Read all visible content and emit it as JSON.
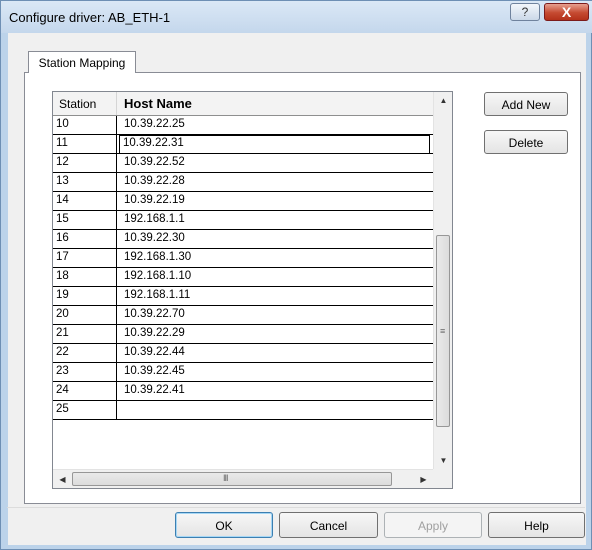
{
  "window": {
    "title": "Configure driver: AB_ETH-1",
    "help_glyph": "?",
    "close_glyph": "X"
  },
  "tab": {
    "label": "Station Mapping"
  },
  "grid": {
    "col_station": "Station",
    "col_host": "Host Name",
    "rows": [
      {
        "station": "10",
        "host": "10.39.22.25"
      },
      {
        "station": "11",
        "host": "10.39.22.31"
      },
      {
        "station": "12",
        "host": "10.39.22.52"
      },
      {
        "station": "13",
        "host": "10.39.22.28"
      },
      {
        "station": "14",
        "host": "10.39.22.19"
      },
      {
        "station": "15",
        "host": "192.168.1.1"
      },
      {
        "station": "16",
        "host": "10.39.22.30"
      },
      {
        "station": "17",
        "host": "192.168.1.30"
      },
      {
        "station": "18",
        "host": "192.168.1.10"
      },
      {
        "station": "19",
        "host": "192.168.1.11"
      },
      {
        "station": "20",
        "host": "10.39.22.70"
      },
      {
        "station": "21",
        "host": "10.39.22.29"
      },
      {
        "station": "22",
        "host": "10.39.22.44"
      },
      {
        "station": "23",
        "host": "10.39.22.45"
      },
      {
        "station": "24",
        "host": "10.39.22.41"
      },
      {
        "station": "25",
        "host": ""
      }
    ],
    "selected_station": "11",
    "scroll_up": "▲",
    "scroll_down": "▼",
    "scroll_left": "◀",
    "scroll_right": "▶",
    "v_grip": "≡",
    "h_grip": "III"
  },
  "side_buttons": {
    "add_new": "Add New",
    "delete": "Delete"
  },
  "footer": {
    "ok": "OK",
    "cancel": "Cancel",
    "apply": "Apply",
    "help": "Help"
  }
}
